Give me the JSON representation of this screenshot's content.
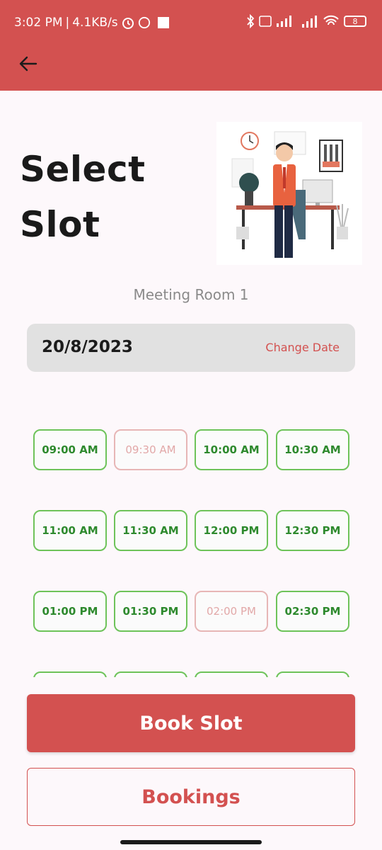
{
  "status_bar": {
    "time": "3:02 PM",
    "net_speed": "4.1KB/s",
    "battery": "8"
  },
  "header": {
    "back_icon": "arrow-left-icon",
    "title_line1": "Select",
    "title_line2": "Slot"
  },
  "room_name": "Meeting Room 1",
  "date_selector": {
    "date": "20/8/2023",
    "change_label": "Change Date"
  },
  "slots": [
    {
      "label": "09:00 AM",
      "state": "available"
    },
    {
      "label": "09:30 AM",
      "state": "booked"
    },
    {
      "label": "10:00 AM",
      "state": "available"
    },
    {
      "label": "10:30 AM",
      "state": "available"
    },
    {
      "label": "11:00 AM",
      "state": "available"
    },
    {
      "label": "11:30 AM",
      "state": "available"
    },
    {
      "label": "12:00 PM",
      "state": "available"
    },
    {
      "label": "12:30 PM",
      "state": "available"
    },
    {
      "label": "01:00 PM",
      "state": "available"
    },
    {
      "label": "01:30 PM",
      "state": "available"
    },
    {
      "label": "02:00 PM",
      "state": "booked"
    },
    {
      "label": "02:30 PM",
      "state": "available"
    }
  ],
  "actions": {
    "book_label": "Book Slot",
    "bookings_label": "Bookings"
  },
  "colors": {
    "accent": "#d35150",
    "available_border": "#6ec35a",
    "booked_border": "#e7b6b6"
  }
}
